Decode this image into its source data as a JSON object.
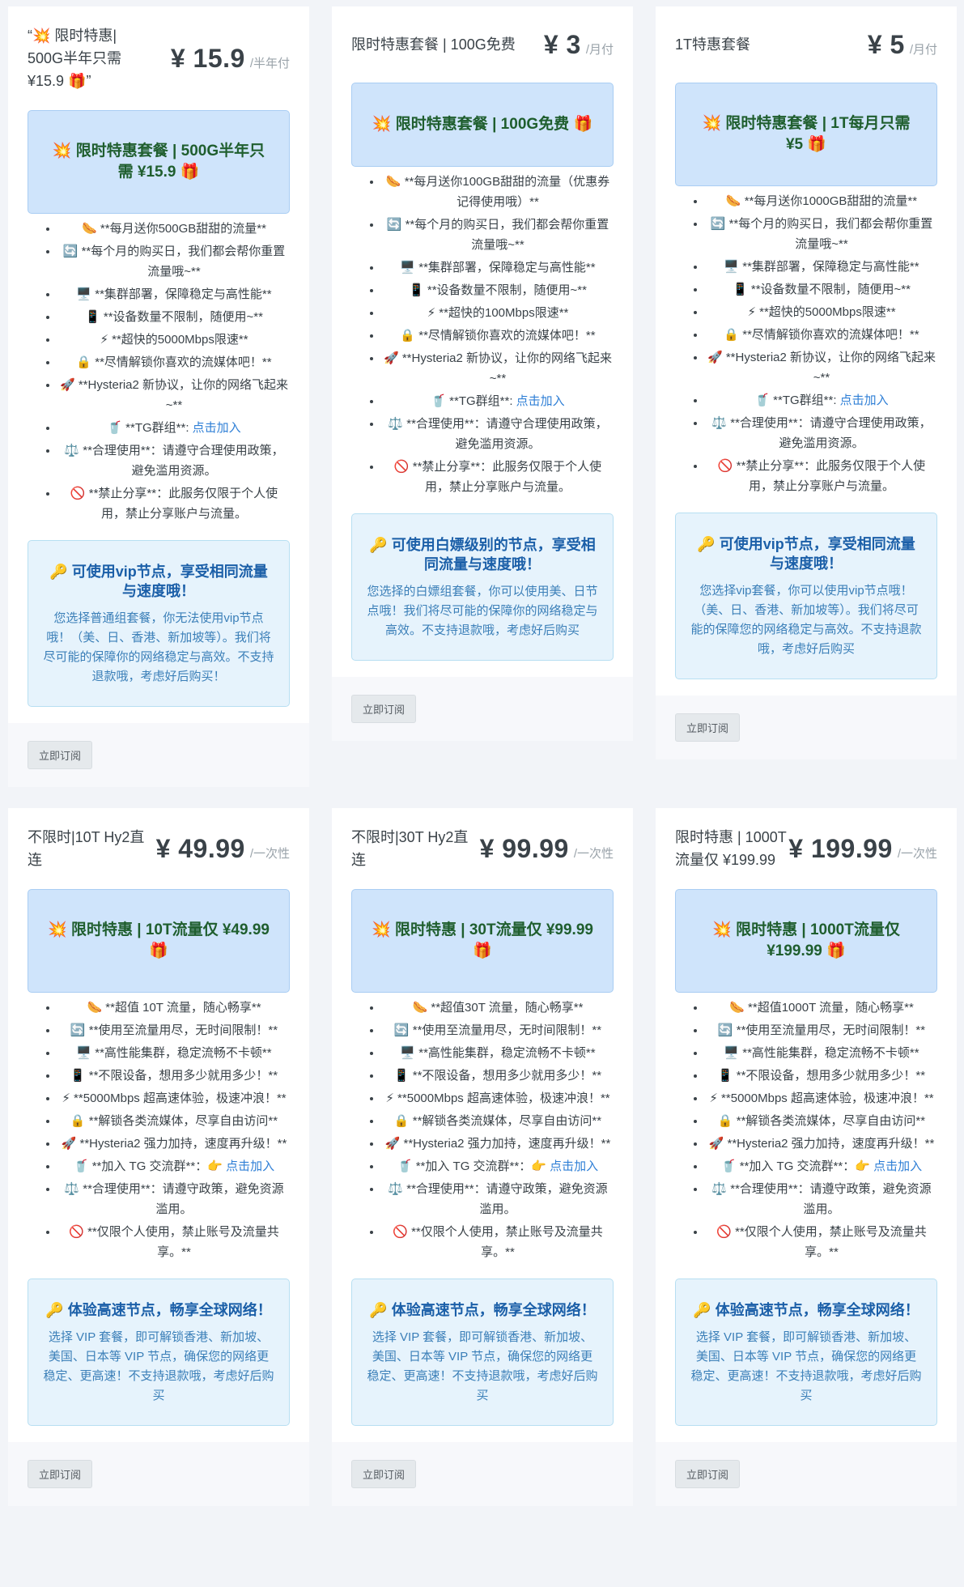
{
  "common": {
    "subscribe_label": "立即订阅",
    "join_label": "点击加入"
  },
  "cards": [
    {
      "title": "“💥 限时特惠| 500G半年只需 ¥15.9 🎁”",
      "price": "¥ 15.9",
      "period": "/半年付",
      "promo": "💥 限时特惠套餐 | 500G半年只需 ¥15.9 🎁",
      "features": [
        "🌭 **每月送你500GB甜甜的流量**",
        "🔄 **每个月的购买日，我们都会帮你重置流量哦~**",
        "🖥️ **集群部署，保障稳定与高性能**",
        "📱 **设备数量不限制，随便用~**",
        "⚡ **超快的5000Mbps限速**",
        "🔒 **尽情解锁你喜欢的流媒体吧！**",
        "🚀 **Hysteria2 新协议，让你的网络飞起来~**",
        "🥤 **TG群组**: ",
        "⚖️ **合理使用**：请遵守合理使用政策，避免滥用资源。",
        "🚫 **禁止分享**：此服务仅限于个人使用，禁止分享账户与流量。"
      ],
      "vip_title": "🔑 可使用vip节点，享受相同流量与速度哦！",
      "vip_desc": "您选择普通组套餐，你无法使用vip节点哦！（美、日、香港、新加坡等）。我们将尽可能的保障你的网络稳定与高效。不支持退款哦，考虑好后购买！"
    },
    {
      "title": "限时特惠套餐 | 100G免费",
      "price": "¥ 3",
      "period": "/月付",
      "promo": "💥 限时特惠套餐 | 100G免费 🎁",
      "features": [
        "🌭 **每月送你100GB甜甜的流量（优惠券记得使用哦）**",
        "🔄 **每个月的购买日，我们都会帮你重置流量哦~**",
        "🖥️ **集群部署，保障稳定与高性能**",
        "📱 **设备数量不限制，随便用~**",
        "⚡ **超快的100Mbps限速**",
        "🔒 **尽情解锁你喜欢的流媒体吧！**",
        "🚀 **Hysteria2 新协议，让你的网络飞起来~**",
        "🥤 **TG群组**: ",
        "⚖️ **合理使用**：请遵守合理使用政策，避免滥用资源。",
        "🚫 **禁止分享**：此服务仅限于个人使用，禁止分享账户与流量。"
      ],
      "vip_title": "🔑 可使用白嫖级别的节点，享受相同流量与速度哦！",
      "vip_desc": "您选择的白嫖组套餐，你可以使用美、日节点哦！我们将尽可能的保障你的网络稳定与高效。不支持退款哦，考虑好后购买"
    },
    {
      "title": "1T特惠套餐",
      "price": "¥ 5",
      "period": "/月付",
      "promo": "💥 限时特惠套餐 | 1T每月只需 ¥5 🎁",
      "features": [
        "🌭 **每月送你1000GB甜甜的流量**",
        "🔄 **每个月的购买日，我们都会帮你重置流量哦~**",
        "🖥️ **集群部署，保障稳定与高性能**",
        "📱 **设备数量不限制，随便用~**",
        "⚡ **超快的5000Mbps限速**",
        "🔒 **尽情解锁你喜欢的流媒体吧！**",
        "🚀 **Hysteria2 新协议，让你的网络飞起来~**",
        "🥤 **TG群组**: ",
        "⚖️ **合理使用**：请遵守合理使用政策，避免滥用资源。",
        "🚫 **禁止分享**：此服务仅限于个人使用，禁止分享账户与流量。"
      ],
      "vip_title": "🔑 可使用vip节点，享受相同流量与速度哦！",
      "vip_desc": "您选择vip套餐，你可以使用vip节点哦！（美、日、香港、新加坡等）。我们将尽可能的保障您的网络稳定与高效。不支持退款哦，考虑好后购买"
    },
    {
      "title": "不限时|10T Hy2直连",
      "price": "¥ 49.99",
      "period": "/一次性",
      "promo": "💥 限时特惠 | 10T流量仅 ¥49.99 🎁",
      "features": [
        "🌭 **超值 10T 流量，随心畅享**",
        "🔄 **使用至流量用尽，无时间限制！**",
        "🖥️ **高性能集群，稳定流畅不卡顿**",
        "📱 **不限设备，想用多少就用多少！**",
        "⚡ **5000Mbps 超高速体验，极速冲浪！**",
        "🔒 **解锁各类流媒体，尽享自由访问**",
        "🚀 **Hysteria2 强力加持，速度再升级！**",
        "🥤 **加入 TG 交流群**：👉 ",
        "⚖️ **合理使用**：请遵守政策，避免资源滥用。",
        "🚫 **仅限个人使用，禁止账号及流量共享。**"
      ],
      "vip_title": "🔑 体验高速节点，畅享全球网络！",
      "vip_desc": "选择 VIP 套餐，即可解锁香港、新加坡、美国、日本等 VIP 节点，确保您的网络更稳定、更高速！不支持退款哦，考虑好后购买"
    },
    {
      "title": "不限时|30T Hy2直连",
      "price": "¥ 99.99",
      "period": "/一次性",
      "promo": "💥 限时特惠 | 30T流量仅 ¥99.99 🎁",
      "features": [
        "🌭 **超值30T 流量，随心畅享**",
        "🔄 **使用至流量用尽，无时间限制！**",
        "🖥️ **高性能集群，稳定流畅不卡顿**",
        "📱 **不限设备，想用多少就用多少！**",
        "⚡ **5000Mbps 超高速体验，极速冲浪！**",
        "🔒 **解锁各类流媒体，尽享自由访问**",
        "🚀 **Hysteria2 强力加持，速度再升级！**",
        "🥤 **加入 TG 交流群**：👉 ",
        "⚖️ **合理使用**：请遵守政策，避免资源滥用。",
        "🚫 **仅限个人使用，禁止账号及流量共享。**"
      ],
      "vip_title": "🔑 体验高速节点，畅享全球网络！",
      "vip_desc": "选择 VIP 套餐，即可解锁香港、新加坡、美国、日本等 VIP 节点，确保您的网络更稳定、更高速！不支持退款哦，考虑好后购买"
    },
    {
      "title": "限时特惠 | 1000T流量仅 ¥199.99",
      "price": "¥ 199.99",
      "period": "/一次性",
      "promo": "💥 限时特惠 | 1000T流量仅 ¥199.99 🎁",
      "features": [
        "🌭 **超值1000T 流量，随心畅享**",
        "🔄 **使用至流量用尽，无时间限制！**",
        "🖥️ **高性能集群，稳定流畅不卡顿**",
        "📱 **不限设备，想用多少就用多少！**",
        "⚡ **5000Mbps 超高速体验，极速冲浪！**",
        "🔒 **解锁各类流媒体，尽享自由访问**",
        "🚀 **Hysteria2 强力加持，速度再升级！**",
        "🥤 **加入 TG 交流群**：👉 ",
        "⚖️ **合理使用**：请遵守政策，避免资源滥用。",
        "🚫 **仅限个人使用，禁止账号及流量共享。**"
      ],
      "vip_title": "🔑 体验高速节点，畅享全球网络！",
      "vip_desc": "选择 VIP 套餐，即可解锁香港、新加坡、美国、日本等 VIP 节点，确保您的网络更稳定、更高速！不支持退款哦，考虑好后购买"
    }
  ]
}
